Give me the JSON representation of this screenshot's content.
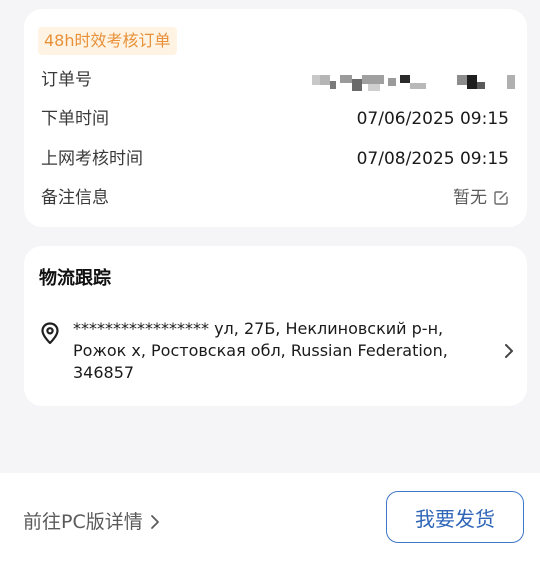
{
  "order_card": {
    "tag": "48h时效考核订单",
    "order_number_label": "订单号",
    "order_time_label": "下单时间",
    "order_time_value": "07/06/2025 09:15",
    "online_check_label": "上网考核时间",
    "online_check_value": "07/08/2025 09:15",
    "remark_label": "备注信息",
    "remark_value": "暂无"
  },
  "logistics_card": {
    "title": "物流跟踪",
    "address": "***************** ул, 27Б, Неклиновский р-н, Рожок х, Ростовская обл, Russian Federation, 346857"
  },
  "footer": {
    "pc_link_label": "前往PC版详情",
    "ship_button_label": "我要发货"
  },
  "colors": {
    "tag_text": "#e8913a",
    "tag_bg": "#fff3e3",
    "primary_button": "#2f66b8",
    "page_bg": "#f5f5f7"
  },
  "icons": {
    "location": "location-pin-icon",
    "remark_edit": "edit-icon",
    "address_chevron": "chevron-right-icon",
    "pc_chevron": "chevron-right-icon"
  }
}
